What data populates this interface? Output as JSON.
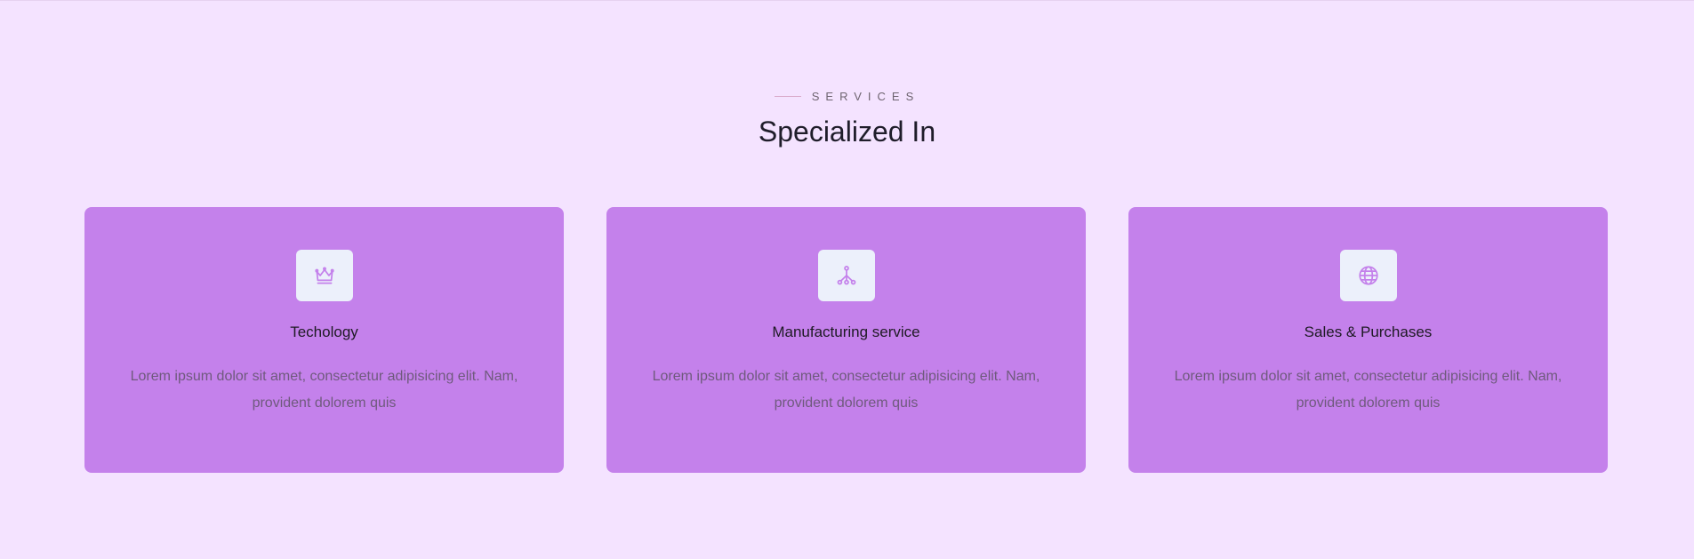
{
  "header": {
    "eyebrow": "SERVICES",
    "title": "Specialized In"
  },
  "colors": {
    "background": "#f4e3ff",
    "card": "#c481eb",
    "icon_box": "#ecf0fb",
    "icon_stroke": "#c481eb"
  },
  "services": [
    {
      "icon": "crown-icon",
      "title": "Techology",
      "description": "Lorem ipsum dolor sit amet, consectetur adipisicing elit. Nam, provident dolorem quis"
    },
    {
      "icon": "network-icon",
      "title": "Manufacturing service",
      "description": "Lorem ipsum dolor sit amet, consectetur adipisicing elit. Nam, provident dolorem quis"
    },
    {
      "icon": "globe-icon",
      "title": "Sales & Purchases",
      "description": "Lorem ipsum dolor sit amet, consectetur adipisicing elit. Nam, provident dolorem quis"
    }
  ]
}
